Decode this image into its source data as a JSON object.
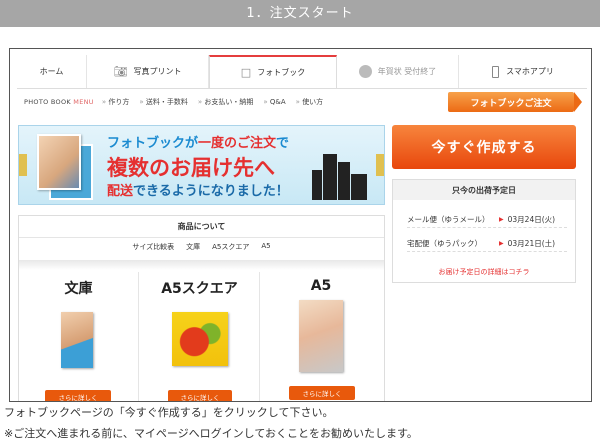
{
  "step": {
    "title": "1．注文スタート"
  },
  "nav": {
    "tabs": [
      {
        "label": "ホーム",
        "icon": ""
      },
      {
        "label": "写真プリント",
        "icon": "camera-icon"
      },
      {
        "label": "フォトブック",
        "icon": "book-icon"
      },
      {
        "label": "年賀状 受付終了",
        "icon": "round-icon"
      },
      {
        "label": "スマホアプリ",
        "icon": "phone-icon"
      }
    ]
  },
  "subnav": {
    "brand": "PHOTO BOOK ",
    "brand_accent": "MENU",
    "links": [
      "作り方",
      "送料・手数料",
      "お支払い・納期",
      "Q&A",
      "使い方"
    ],
    "order_button": "フォトブックご注文"
  },
  "banner": {
    "line1_a": "フォトブックが",
    "line1_b": "一度のご注文",
    "line1_c": "で",
    "line2": "複数のお届け先へ",
    "line3_a": "配送",
    "line3_b": "できるようになりました！"
  },
  "start_button": "今すぐ作成する",
  "shipping": {
    "title": "只今の出荷予定日",
    "rows": [
      {
        "label": "メール便（ゆうメール）",
        "date": "03月24日(火)"
      },
      {
        "label": "宅配便（ゆうパック）",
        "date": "03月21日(土)"
      }
    ],
    "link": "お届け予定日の詳細はコチラ"
  },
  "products": {
    "heading": "商品について",
    "sizes": [
      "サイズ比較表",
      "文庫",
      "A5スクエア",
      "A5"
    ],
    "items": [
      {
        "name": "文庫",
        "more": "さらに詳しく"
      },
      {
        "name": "A5スクエア",
        "more": "さらに詳しく"
      },
      {
        "name": "A5",
        "more": "さらに詳しく"
      }
    ]
  },
  "footer": {
    "line1": "フォトブックページの「今すぐ作成する」をクリックして下さい。",
    "line2": "※ご注文へ進まれる前に、マイページへログインしておくことをお勧めいたします。"
  },
  "colors": {
    "accent": "#e8470c",
    "nav_active": "#e53d3d",
    "banner_blue": "#1a8ad0",
    "banner_red": "#e53030"
  }
}
